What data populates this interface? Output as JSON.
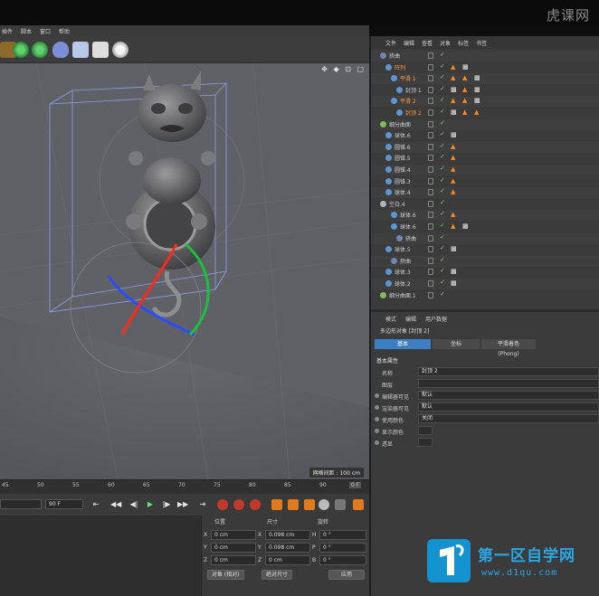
{
  "watermark": "虎课网",
  "menubar": [
    "插件",
    "脚本",
    "窗口",
    "帮助"
  ],
  "viewport": {
    "grid_status": "网格间距 : 100 cm",
    "tools": "✥ ◆ ⊡ ▢"
  },
  "timeline": {
    "ticks": [
      "45",
      "50",
      "55",
      "60",
      "65",
      "70",
      "75",
      "80",
      "85",
      "90"
    ],
    "end_frame": "0 F"
  },
  "transport": {
    "start_field": "",
    "end_field": "90 F",
    "buttons": [
      "⇤",
      "◀◀",
      "◀|",
      "▶",
      "|▶",
      "▶▶",
      "⇥"
    ]
  },
  "object_manager": {
    "menu": [
      "文件",
      "编辑",
      "查看",
      "对象",
      "标签",
      "书签"
    ],
    "rows": [
      {
        "name": "挤曲",
        "indent": 0,
        "icon_color": "#6f86b3",
        "highlight": false,
        "tags": []
      },
      {
        "name": "阵列",
        "indent": 6,
        "icon_color": "#5c96d4",
        "highlight": true,
        "tags": [
          "orange",
          "checker"
        ]
      },
      {
        "name": "平滑 1",
        "indent": 12,
        "icon_color": "#5c96d4",
        "highlight": true,
        "tags": [
          "orange",
          "orange",
          "checker"
        ]
      },
      {
        "name": "封顶 1",
        "indent": 18,
        "icon_color": "#5c96d4",
        "highlight": false,
        "tags": [
          "checker",
          "orange",
          "checker"
        ]
      },
      {
        "name": "平滑 2",
        "indent": 12,
        "icon_color": "#5c96d4",
        "highlight": true,
        "tags": [
          "orange",
          "orange",
          "checker"
        ]
      },
      {
        "name": "封顶 2",
        "indent": 18,
        "icon_color": "#5c96d4",
        "highlight": true,
        "tags": [
          "checker",
          "orange",
          "orange"
        ]
      },
      {
        "name": "细分曲面",
        "indent": 0,
        "icon_color": "#7fbf5a",
        "highlight": false,
        "tags": []
      },
      {
        "name": "球体.6",
        "indent": 6,
        "icon_color": "#5c96d4",
        "highlight": false,
        "tags": [
          "checker"
        ]
      },
      {
        "name": "圆锥.6",
        "indent": 6,
        "icon_color": "#5c96d4",
        "highlight": false,
        "tags": [
          "orange"
        ]
      },
      {
        "name": "圆锥.5",
        "indent": 6,
        "icon_color": "#5c96d4",
        "highlight": false,
        "tags": [
          "orange"
        ]
      },
      {
        "name": "圆锥.4",
        "indent": 6,
        "icon_color": "#5c96d4",
        "highlight": false,
        "tags": [
          "orange"
        ]
      },
      {
        "name": "圆锥.3",
        "indent": 6,
        "icon_color": "#5c96d4",
        "highlight": false,
        "tags": [
          "orange"
        ]
      },
      {
        "name": "球体.4",
        "indent": 6,
        "icon_color": "#5c96d4",
        "highlight": false,
        "tags": [
          "orange"
        ]
      },
      {
        "name": "空白.4",
        "indent": 0,
        "icon_color": "#b3b3b3",
        "highlight": false,
        "tags": []
      },
      {
        "name": "球体.6",
        "indent": 12,
        "icon_color": "#5c96d4",
        "highlight": false,
        "tags": [
          "orange"
        ]
      },
      {
        "name": "球体.6",
        "indent": 12,
        "icon_color": "#5c96d4",
        "highlight": false,
        "tags": [
          "orange",
          "checker"
        ]
      },
      {
        "name": "挤曲",
        "indent": 18,
        "icon_color": "#6f86b3",
        "highlight": false,
        "tags": []
      },
      {
        "name": "球体.5",
        "indent": 6,
        "icon_color": "#5c96d4",
        "highlight": false,
        "tags": [
          "checker"
        ]
      },
      {
        "name": "挤曲",
        "indent": 12,
        "icon_color": "#6f86b3",
        "highlight": false,
        "tags": []
      },
      {
        "name": "球体.3",
        "indent": 6,
        "icon_color": "#5c96d4",
        "highlight": false,
        "tags": [
          "checker"
        ]
      },
      {
        "name": "球体.2",
        "indent": 6,
        "icon_color": "#5c96d4",
        "highlight": false,
        "tags": [
          "checker"
        ]
      },
      {
        "name": "细分曲面.1",
        "indent": 0,
        "icon_color": "#7fbf5a",
        "highlight": false,
        "tags": []
      }
    ]
  },
  "attributes": {
    "tabs": [
      "模式",
      "编辑",
      "用户数据"
    ],
    "title": "多边形对象 [封顶 2]",
    "subtabs": [
      {
        "label": "基本",
        "active": true
      },
      {
        "label": "坐标",
        "active": false
      },
      {
        "label": "平滑着色(Phong)",
        "active": false
      }
    ],
    "section": "基本属性",
    "rows": [
      {
        "label": "名称",
        "value": "封顶 2",
        "radio": false
      },
      {
        "label": "图层",
        "value": "",
        "radio": false
      },
      {
        "label": "编辑器可见",
        "value": "默认",
        "radio": true
      },
      {
        "label": "渲染器可见",
        "value": "默认",
        "radio": true
      },
      {
        "label": "使用颜色",
        "value": "关闭",
        "radio": true
      },
      {
        "label": "显示颜色",
        "value": "",
        "radio": true
      },
      {
        "label": "透显",
        "value": "",
        "radio": true
      }
    ]
  },
  "coordinates": {
    "headers": [
      "位置",
      "尺寸",
      "旋转"
    ],
    "rows": [
      {
        "axis": "X",
        "pos": "0 cm",
        "size_axis": "X",
        "size": "0.098 cm",
        "rot_axis": "H",
        "rot": "0 °"
      },
      {
        "axis": "Y",
        "pos": "0 cm",
        "size_axis": "Y",
        "size": "0.098 cm",
        "rot_axis": "P",
        "rot": "0 °"
      },
      {
        "axis": "Z",
        "pos": "0 cm",
        "size_axis": "Z",
        "size": "0 cm",
        "rot_axis": "B",
        "rot": "0 °"
      }
    ],
    "mode_select": "对象 (相对)",
    "size_select": "绝对尺寸",
    "apply": "应用"
  },
  "logo": {
    "main": "第一区自学网",
    "url": "www.d1qu.com"
  }
}
